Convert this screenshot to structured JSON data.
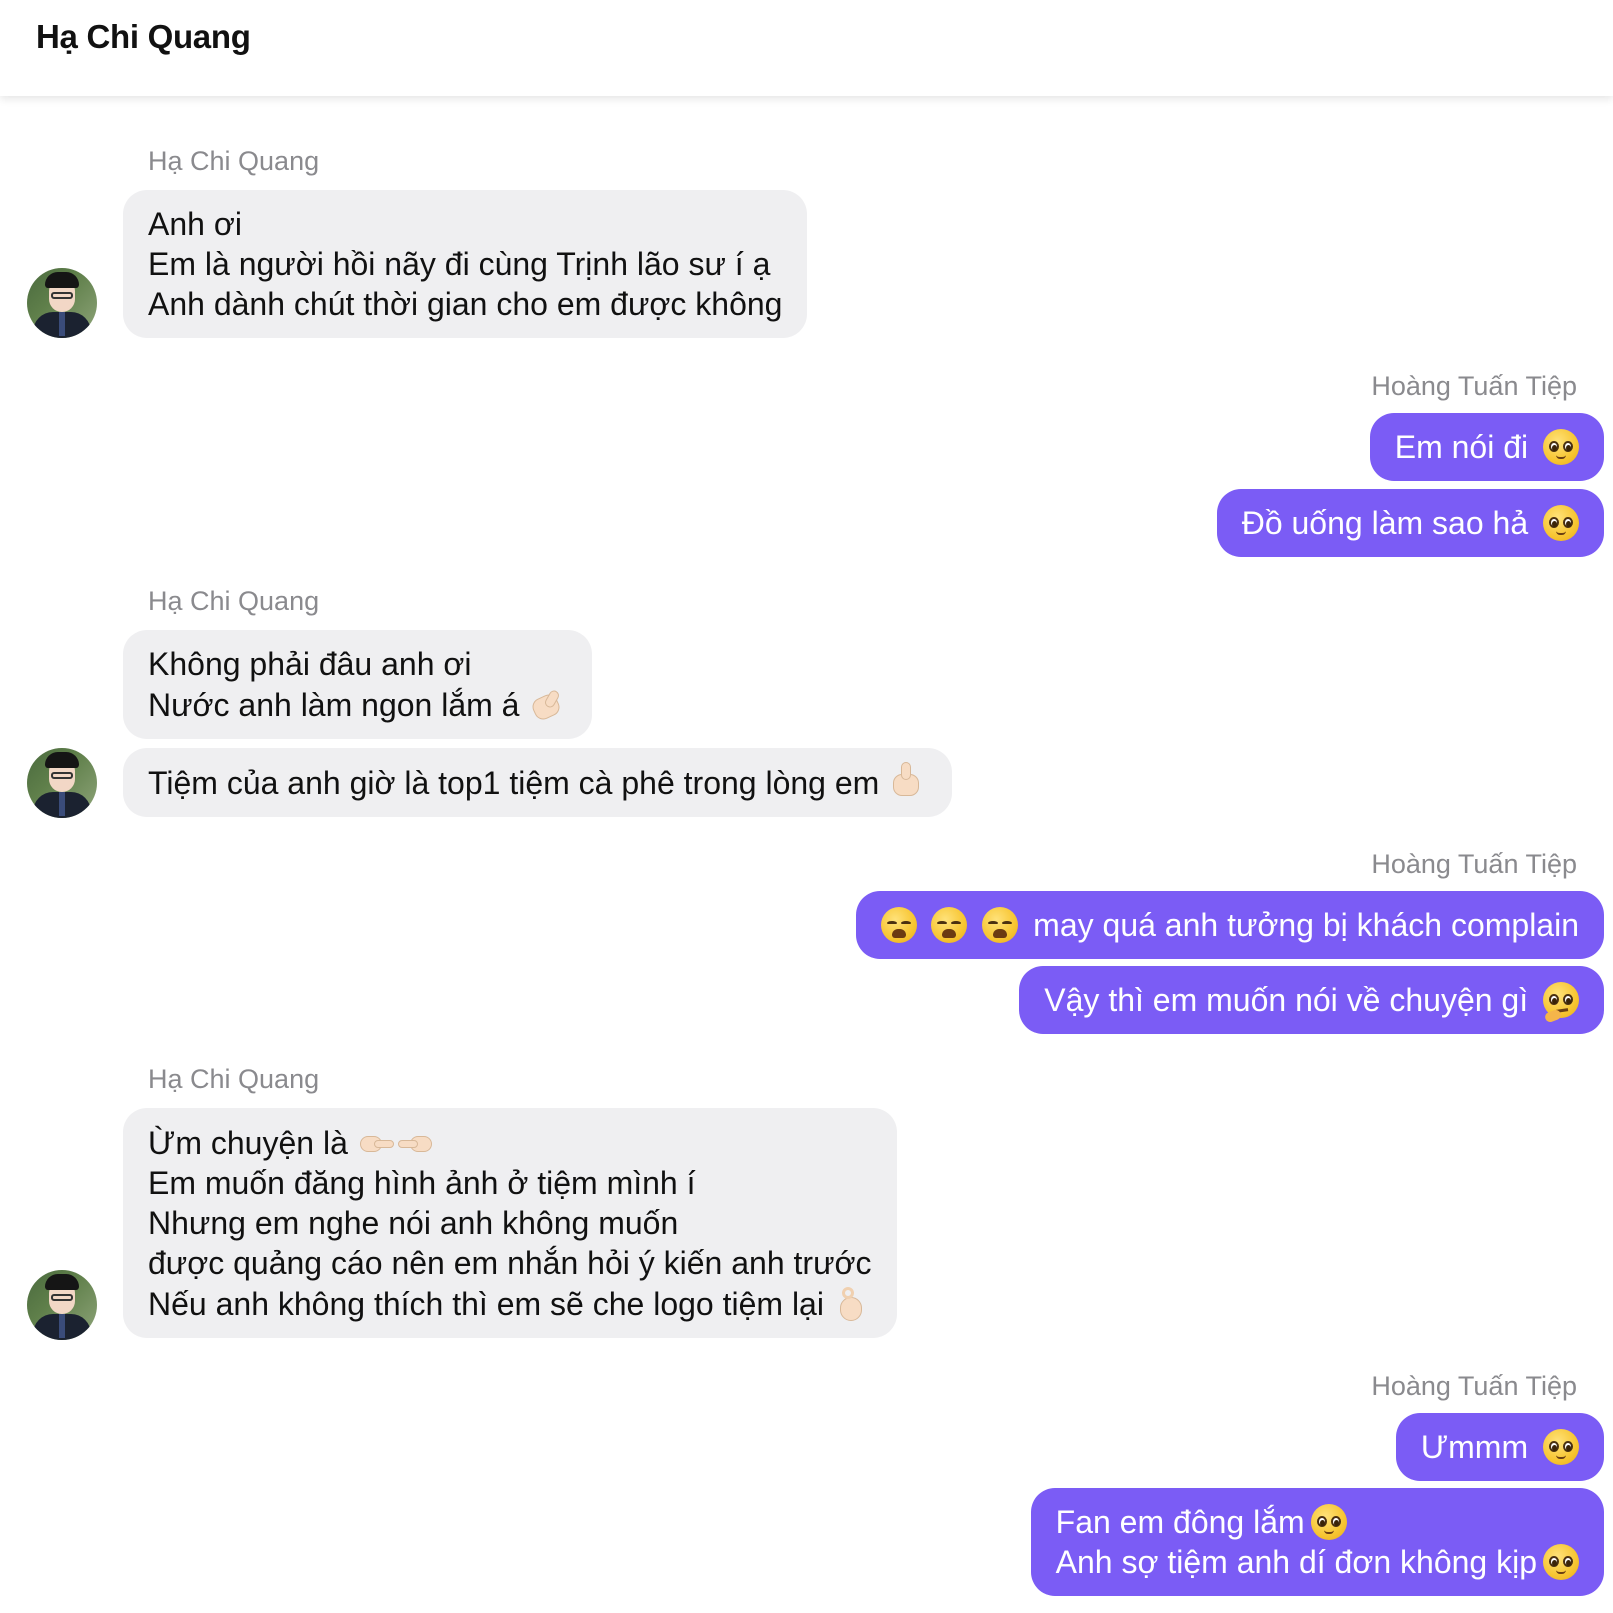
{
  "header": {
    "title": "Hạ Chi Quang"
  },
  "senders": {
    "left": "Hạ Chi Quang",
    "right": "Hoàng Tuấn Tiệp"
  },
  "messages": {
    "g1": {
      "sender": "Hạ Chi Quang",
      "b1": [
        "Anh ơi",
        "Em là người hồi nãy đi cùng Trịnh lão sư í ạ",
        "Anh dành chút thời gian cho em được không"
      ]
    },
    "g2": {
      "sender": "Hoàng Tuấn Tiệp",
      "b1": "Em nói đi",
      "b2": "Đồ uống làm sao hả"
    },
    "g3": {
      "sender": "Hạ Chi Quang",
      "b1": [
        "Không phải đâu anh ơi",
        "Nước anh làm ngon lắm á"
      ],
      "b2": "Tiệm của anh giờ là top1 tiệm cà phê trong lòng em"
    },
    "g4": {
      "sender": "Hoàng Tuấn Tiệp",
      "b1": "may quá anh tưởng bị khách complain",
      "b2": "Vậy thì em muốn nói về chuyện gì"
    },
    "g5": {
      "sender": "Hạ Chi Quang",
      "b1": [
        "Ừm chuyện là",
        "Em muốn đăng hình ảnh ở tiệm mình í",
        "Nhưng em nghe nói anh không muốn",
        "được quảng cáo nên em nhắn hỏi ý kiến anh trước",
        "Nếu anh không thích thì em sẽ che logo tiệm lại"
      ]
    },
    "g6": {
      "sender": "Hoàng Tuấn Tiệp",
      "b1": "Ưmmm",
      "b2": [
        "Fan em đông lắm",
        "Anh sợ tiệm anh dí đơn không kịp"
      ]
    }
  },
  "icons": {
    "pleading": "pleading-face-icon",
    "weary": "weary-face-icon",
    "thinking": "thinking-face-icon",
    "clap": "clapping-hands-icon",
    "thumbs": "thumbs-up-icon",
    "point": "pointing-finger-icon",
    "ok": "ok-hand-icon"
  },
  "colors": {
    "outgoing_bubble": "#7b5cf5",
    "incoming_bubble": "#efeff1",
    "sender_label": "#8a8a8e"
  }
}
